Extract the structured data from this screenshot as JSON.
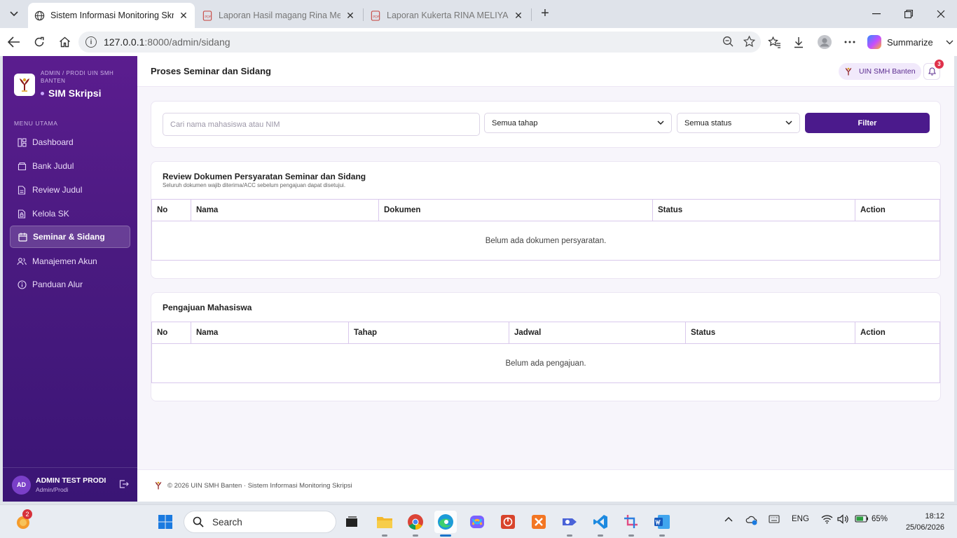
{
  "browser": {
    "tabs": [
      {
        "title": "Sistem Informasi Monitoring Skrip",
        "active": true
      },
      {
        "title": "Laporan Hasil magang Rina Meliya",
        "active": false
      },
      {
        "title": "Laporan Kukerta RINA MELIYANA",
        "active": false
      }
    ],
    "url_host": "127.0.0.1",
    "url_rest": ":8000/admin/sidang",
    "summarize_label": "Summarize"
  },
  "sidebar": {
    "brand_sub": "ADMIN / PRODI UIN SMH BANTEN",
    "brand_name": "SIM Skripsi",
    "section_label": "MENU UTAMA",
    "items": [
      {
        "label": "Dashboard",
        "icon": "dashboard-icon"
      },
      {
        "label": "Bank Judul",
        "icon": "book-icon"
      },
      {
        "label": "Review Judul",
        "icon": "document-icon"
      },
      {
        "label": "Kelola SK",
        "icon": "file-lock-icon"
      },
      {
        "label": "Seminar & Sidang",
        "icon": "calendar-icon",
        "active": true
      },
      {
        "label": "Manajemen Akun",
        "icon": "users-icon"
      },
      {
        "label": "Panduan Alur",
        "icon": "info-icon"
      }
    ],
    "user": {
      "initials": "AD",
      "name": "ADMIN TEST PRODI",
      "role": "Admin/Prodi"
    }
  },
  "header": {
    "title": "Proses Seminar dan Sidang",
    "institution": "UIN SMH Banten",
    "notification_count": "3"
  },
  "filter": {
    "search_placeholder": "Cari nama mahasiswa atau NIM",
    "stage_select": "Semua tahap",
    "status_select": "Semua status",
    "button_label": "Filter"
  },
  "documents": {
    "title": "Review Dokumen Persyaratan Seminar dan Sidang",
    "subtitle": "Seluruh dokumen wajib diterima/ACC sebelum pengajuan dapat disetujui.",
    "columns": [
      "No",
      "Nama",
      "Dokumen",
      "Status",
      "Action"
    ],
    "empty_text": "Belum ada dokumen persyaratan."
  },
  "submissions": {
    "title": "Pengajuan Mahasiswa",
    "columns": [
      "No",
      "Nama",
      "Tahap",
      "Jadwal",
      "Status",
      "Action"
    ],
    "empty_text": "Belum ada pengajuan."
  },
  "footer": {
    "text": "© 2026 UIN SMH Banten · Sistem Informasi Monitoring Skripsi"
  },
  "taskbar": {
    "search_label": "Search",
    "weather_badge": "2",
    "language": "ENG",
    "battery": "65%",
    "time": "18:12",
    "date": "25/06/2026"
  },
  "colors": {
    "primary": "#4b1a8c",
    "sidebar": "#5b1d8f",
    "badge": "#e0314b"
  }
}
